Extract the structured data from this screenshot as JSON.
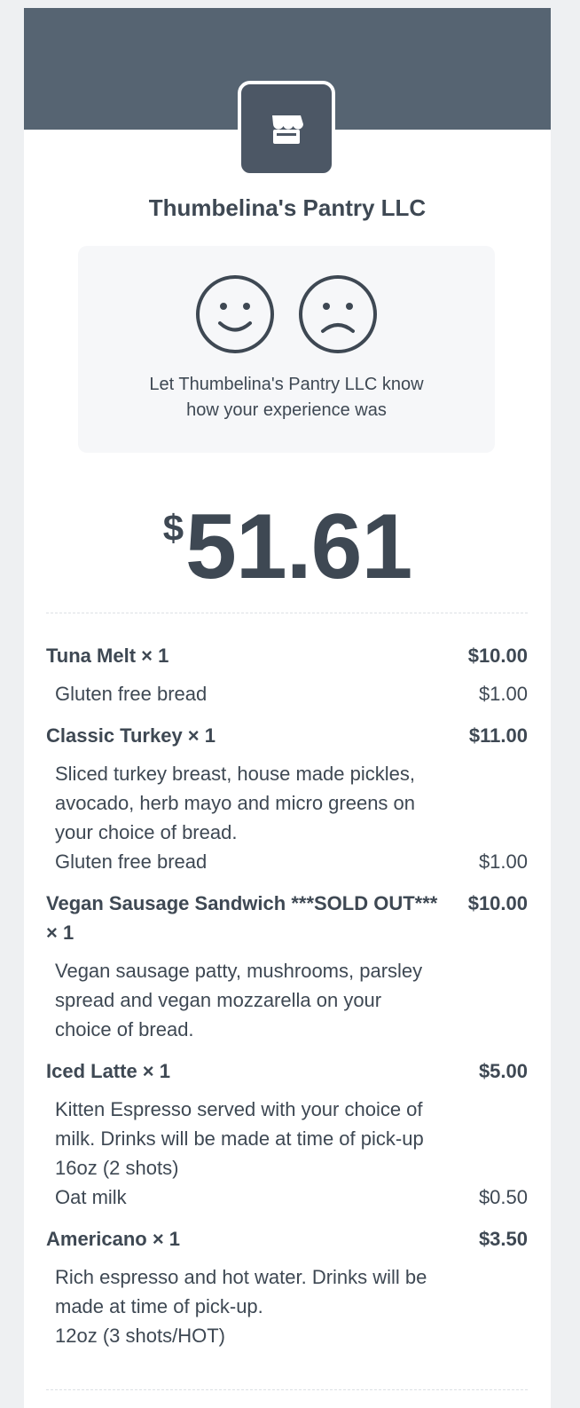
{
  "merchant": {
    "name": "Thumbelina's Pantry LLC",
    "logo_icon": "store-icon"
  },
  "feedback": {
    "line1": "Let Thumbelina's Pantry LLC know",
    "line2": "how your experience was",
    "happy_icon": "happy-face-icon",
    "sad_icon": "sad-face-icon"
  },
  "total": {
    "currency": "$",
    "amount": "51.61"
  },
  "items": [
    {
      "name": "Tuna Melt × 1",
      "price": "$10.00",
      "description": [],
      "modifiers": [
        {
          "label": "Gluten free bread",
          "price": "$1.00"
        }
      ]
    },
    {
      "name": "Classic Turkey × 1",
      "price": "$11.00",
      "description": [
        "Sliced turkey breast, house made pickles,",
        "avocado, herb mayo and micro greens on",
        "your choice of bread."
      ],
      "modifiers": [
        {
          "label": "Gluten free bread",
          "price": "$1.00"
        }
      ]
    },
    {
      "name": "Vegan Sausage Sandwich ***SOLD OUT***",
      "name_line2": "× 1",
      "price": "$10.00",
      "description": [
        "Vegan sausage patty, mushrooms, parsley",
        "spread and vegan mozzarella on your",
        "choice of bread."
      ],
      "modifiers": []
    },
    {
      "name": "Iced Latte × 1",
      "price": "$5.00",
      "description": [
        "Kitten Espresso served with your choice of",
        "milk. Drinks will be made at time of pick-up",
        "16oz (2 shots)"
      ],
      "modifiers": [
        {
          "label": "Oat milk",
          "price": "$0.50"
        }
      ]
    },
    {
      "name": "Americano × 1",
      "price": "$3.50",
      "description": [
        "Rich espresso and hot water. Drinks will be",
        "made at time of pick-up.",
        "12oz (3 shots/HOT)"
      ],
      "modifiers": []
    }
  ]
}
